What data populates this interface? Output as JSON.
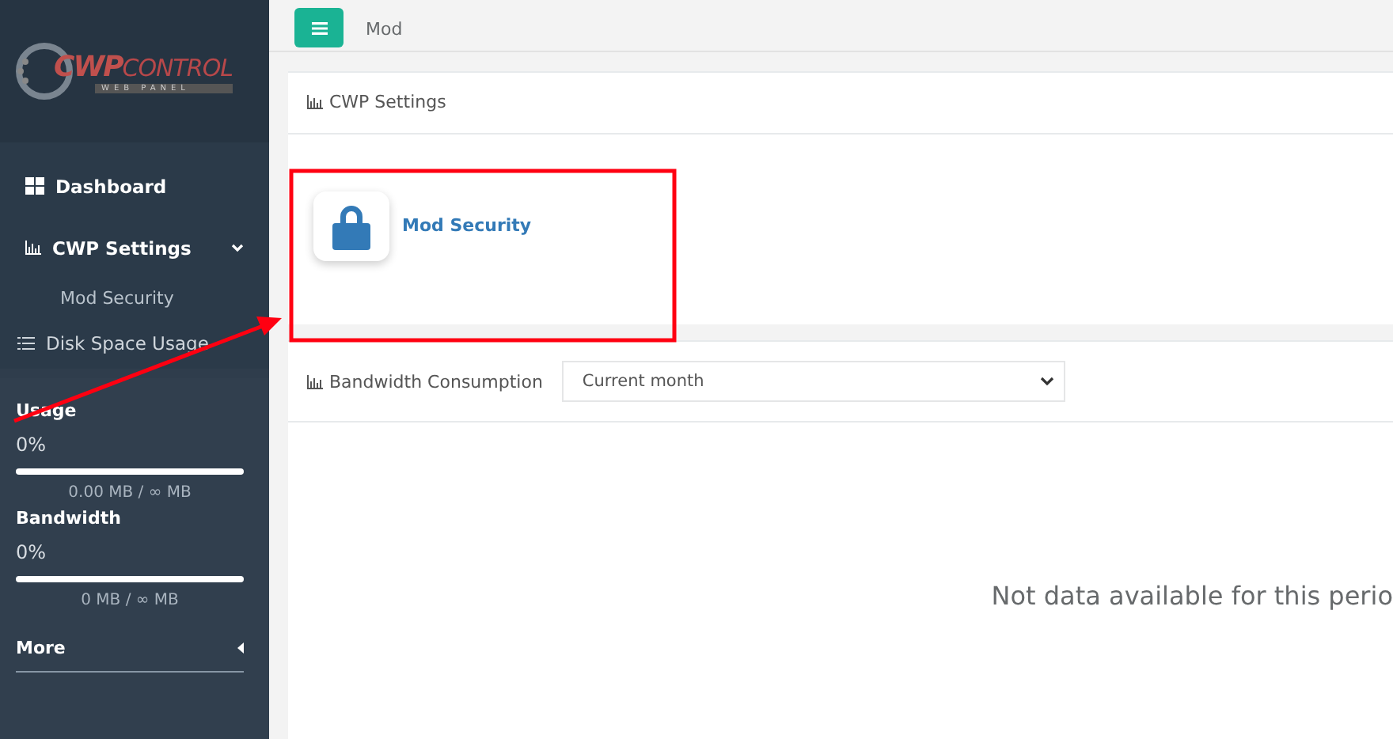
{
  "sidebar": {
    "logo": {
      "brand": "CWP",
      "name": "CONTROL",
      "tagline": "WEB PANEL"
    },
    "menu": [
      {
        "label": "Dashboard"
      },
      {
        "label": "CWP Settings",
        "expanded": true,
        "children": [
          {
            "label": "Mod Security"
          }
        ]
      },
      {
        "label": "Disk Space Usage"
      }
    ],
    "stats": [
      {
        "title": "Usage",
        "percent": "0%",
        "level": 0,
        "reading": "0.00 MB / ∞ MB"
      },
      {
        "title": "Bandwidth",
        "percent": "0%",
        "level": 0,
        "reading": "0 MB / ∞ MB"
      }
    ],
    "more": "More"
  },
  "topbar": {
    "breadcrumb": "Mod"
  },
  "settings_panel": {
    "title": "CWP Settings",
    "tiles": [
      {
        "label": "Mod Security"
      }
    ]
  },
  "bandwidth_panel": {
    "title": "Bandwidth Consumption",
    "period": "Current month",
    "message": "Not data available for this perio"
  }
}
